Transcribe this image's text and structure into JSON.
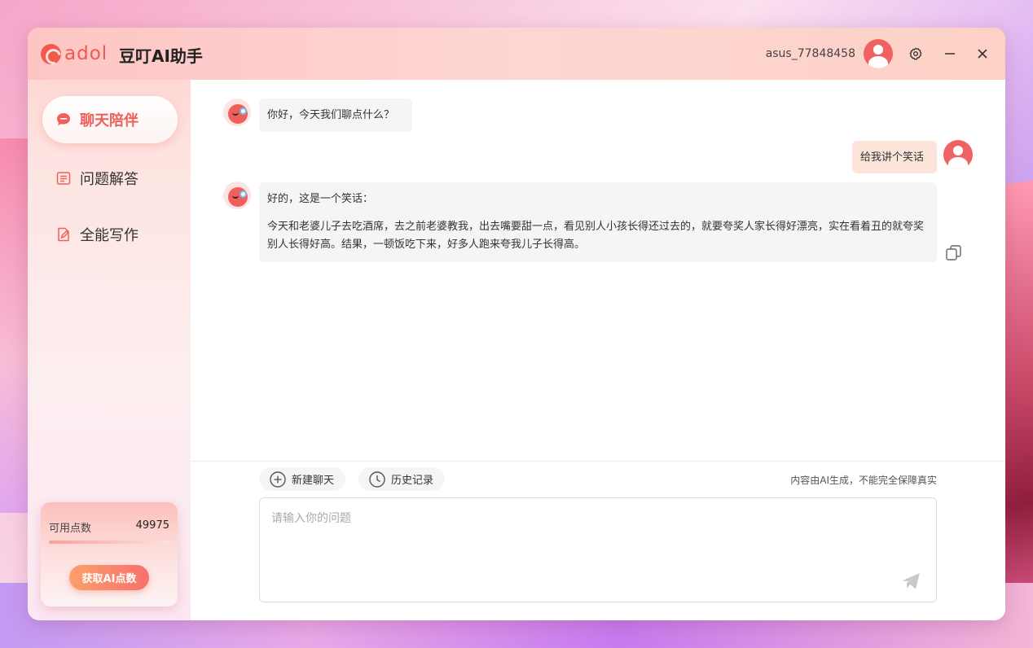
{
  "app": {
    "logo_text": "adol",
    "title": "豆叮AI助手",
    "username": "asus_77848458"
  },
  "sidebar": {
    "items": [
      {
        "label": "聊天陪伴",
        "icon": "chat-bubble-icon",
        "active": true
      },
      {
        "label": "问题解答",
        "icon": "document-list-icon",
        "active": false
      },
      {
        "label": "全能写作",
        "icon": "edit-document-icon",
        "active": false
      }
    ],
    "points": {
      "label": "可用点数",
      "value": "49975",
      "progress": 1.0,
      "button_label": "获取AI点数"
    }
  },
  "chat": {
    "messages": [
      {
        "role": "bot",
        "text": "你好，今天我们聊点什么？"
      },
      {
        "role": "user",
        "text": "给我讲个笑话"
      },
      {
        "role": "bot",
        "text": "好的，这是一个笑话：",
        "text2": "今天和老婆儿子去吃酒席，去之前老婆教我，出去嘴要甜一点，看见别人小孩长得还过去的，就要夸奖人家长得好漂亮，实在看着丑的就夸奖别人长得好高。结果，一顿饭吃下来，好多人跑来夸我儿子长得高。"
      }
    ]
  },
  "composer": {
    "new_chat_label": "新建聊天",
    "history_label": "历史记录",
    "disclaimer": "内容由AI生成，不能完全保障真实",
    "placeholder": "请输入你的问题",
    "value": ""
  },
  "colors": {
    "accent": "#f0605a",
    "user_bubble": "#fde4db",
    "bot_bubble": "#f5f5f5"
  }
}
